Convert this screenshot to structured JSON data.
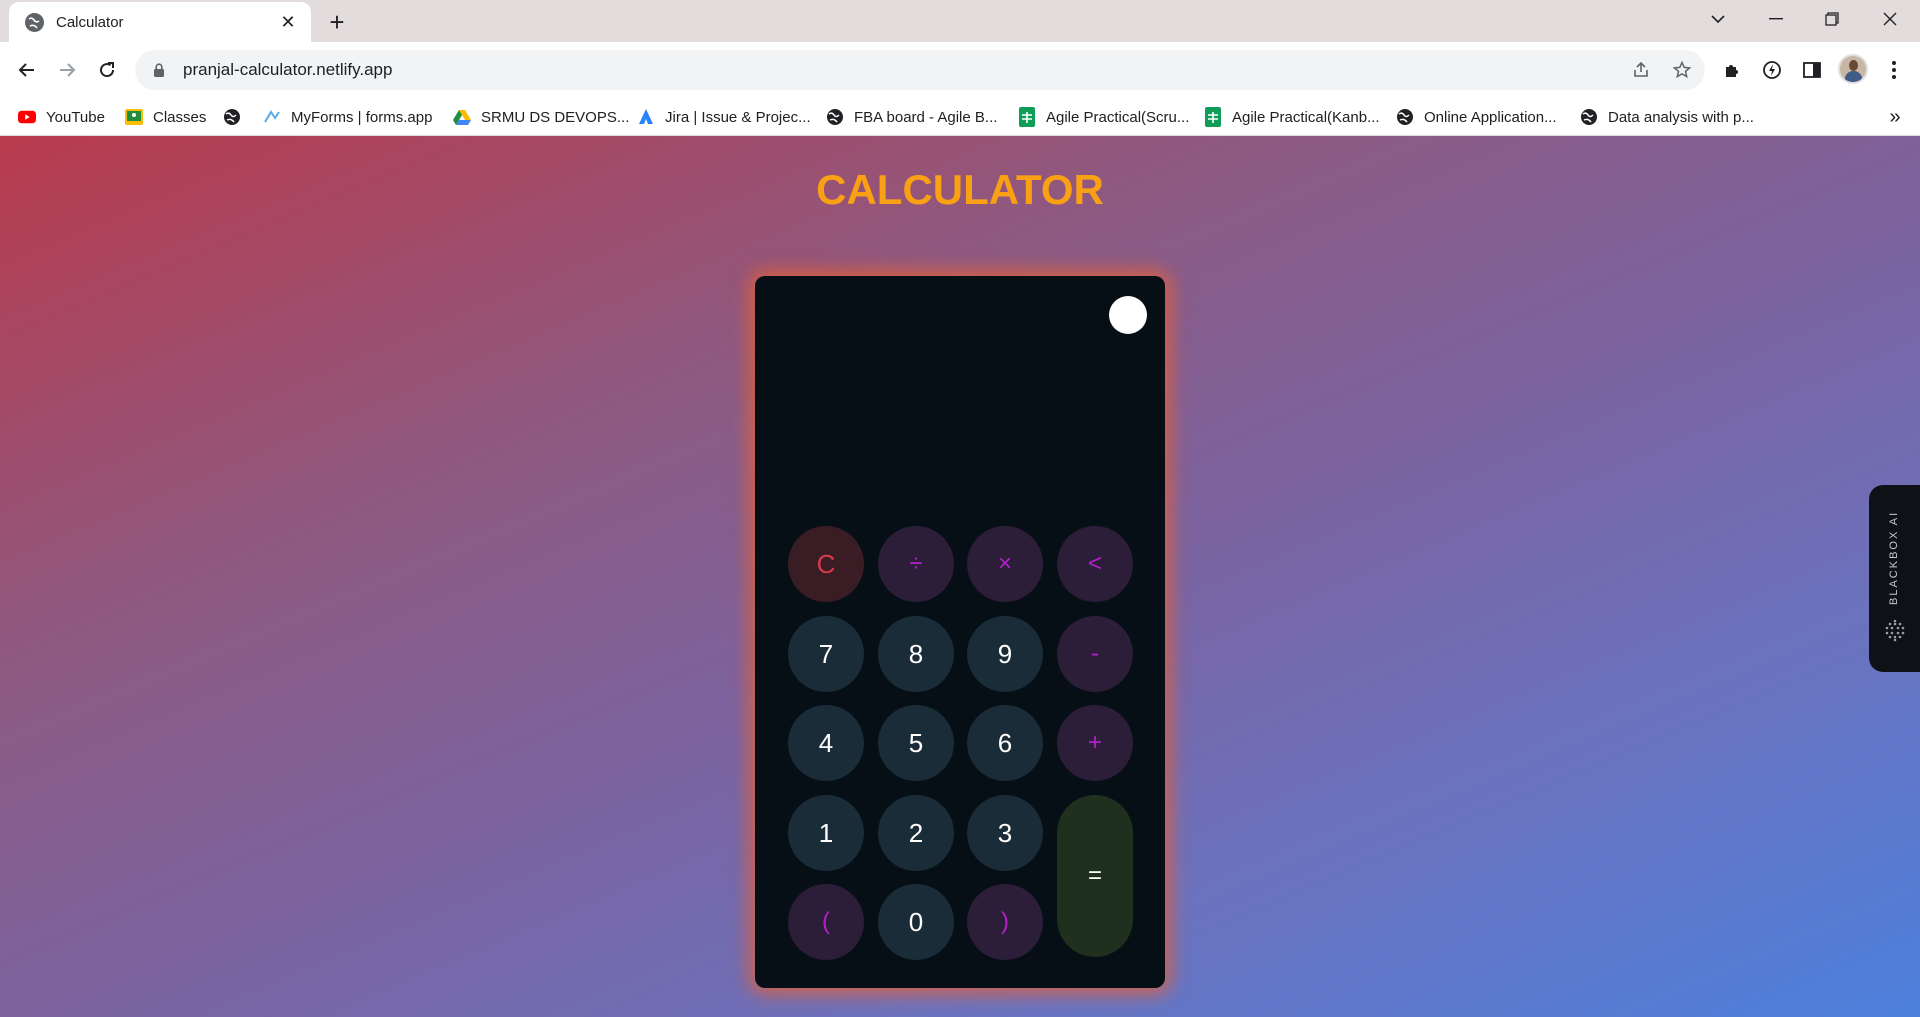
{
  "browser": {
    "tab_title": "Calculator",
    "new_tab_label": "+",
    "url": "pranjal-calculator.netlify.app"
  },
  "bookmarks": [
    {
      "label": "YouTube",
      "icon": "youtube-icon"
    },
    {
      "label": "Classes",
      "icon": "classroom-icon"
    },
    {
      "label": "",
      "icon": "globe-icon"
    },
    {
      "label": "MyForms | forms.app",
      "icon": "forms-icon"
    },
    {
      "label": "SRMU DS DEVOPS...",
      "icon": "drive-icon"
    },
    {
      "label": "Jira | Issue & Projec...",
      "icon": "jira-icon"
    },
    {
      "label": "FBA board - Agile B...",
      "icon": "globe-icon"
    },
    {
      "label": "Agile Practical(Scru...",
      "icon": "sheets-icon"
    },
    {
      "label": "Agile Practical(Kanb...",
      "icon": "sheets-icon"
    },
    {
      "label": "Online Application...",
      "icon": "globe-icon"
    },
    {
      "label": "Data analysis with p...",
      "icon": "globe-icon"
    }
  ],
  "page": {
    "title": "CALCULATOR",
    "display_value": ""
  },
  "keys": {
    "clear": "C",
    "divide": "÷",
    "multiply": "×",
    "backspace": "<",
    "seven": "7",
    "eight": "8",
    "nine": "9",
    "minus": "-",
    "four": "4",
    "five": "5",
    "six": "6",
    "plus": "+",
    "one": "1",
    "two": "2",
    "three": "3",
    "equals": "=",
    "open_paren": "(",
    "zero": "0",
    "close_paren": ")"
  },
  "side_panel": {
    "label": "BLACKBOX AI"
  },
  "colors": {
    "title": "#f9a015",
    "calculator_bg": "#070f16",
    "number_key": "#1a2c38",
    "operator_key": "#2c1d39",
    "operator_text": "#b221c8",
    "clear_key": "#3a1c24",
    "clear_text": "#d83a4c",
    "equals_key": "#20301f",
    "glow": "#e0603a"
  }
}
